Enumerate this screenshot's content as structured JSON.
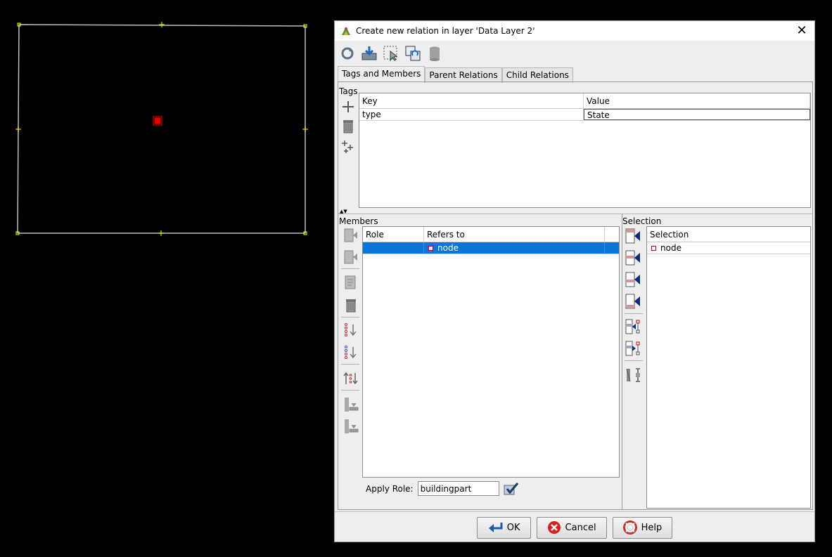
{
  "dialog": {
    "title": "Create new relation in layer 'Data Layer 2'",
    "close_glyph": "✕"
  },
  "toolbar": {
    "icons": [
      "refresh-icon",
      "apply-icon",
      "select-icon",
      "duplicate-icon",
      "delete-relation-icon"
    ]
  },
  "tabs": [
    {
      "label": "Tags and Members",
      "active": true
    },
    {
      "label": "Parent Relations",
      "active": false
    },
    {
      "label": "Child Relations",
      "active": false
    }
  ],
  "tags": {
    "section_label": "Tags",
    "columns": [
      "Key",
      "Value"
    ],
    "rows": [
      {
        "key": "type",
        "value": "State"
      }
    ]
  },
  "members": {
    "section_label": "Members",
    "columns": [
      "Role",
      "Refers to"
    ],
    "rows": [
      {
        "role": "",
        "refers_to": "node"
      }
    ],
    "apply_role_label": "Apply Role:",
    "apply_role_value": "buildingpart"
  },
  "selection": {
    "section_label": "Selection",
    "column": "Selection",
    "rows": [
      {
        "label": "node"
      }
    ]
  },
  "buttons": {
    "ok": "OK",
    "cancel": "Cancel",
    "help": "Help"
  },
  "colors": {
    "selected_row": "#0a74d8",
    "map_background": "#000000",
    "map_node": "#e00000",
    "map_handle": "#ffff00"
  }
}
